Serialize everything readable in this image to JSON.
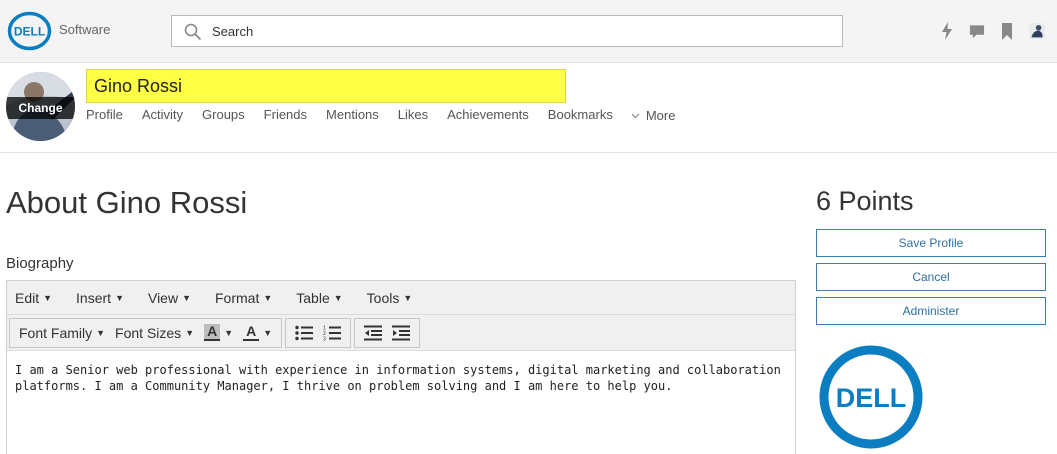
{
  "header": {
    "brand_text": "Software",
    "logo_text": "DELL",
    "search": {
      "placeholder": "Search",
      "value": ""
    },
    "icons": [
      "lightning-icon",
      "chat-icon",
      "bookmark-icon",
      "user-avatar"
    ]
  },
  "profile": {
    "avatar_change_label": "Change",
    "name": "Gino Rossi",
    "nav": [
      "Profile",
      "Activity",
      "Groups",
      "Friends",
      "Mentions",
      "Likes",
      "Achievements",
      "Bookmarks"
    ],
    "more_label": "More"
  },
  "main": {
    "title": "About Gino Rossi",
    "biography_label": "Biography",
    "editor": {
      "menus": [
        "Edit",
        "Insert",
        "View",
        "Format",
        "Table",
        "Tools"
      ],
      "font_family_label": "Font Family",
      "font_sizes_label": "Font Sizes",
      "bg_color_glyph": "A",
      "text_color_glyph": "A",
      "content": "I am a Senior web professional with experience in information systems, digital marketing and collaboration platforms.  I am a Community Manager, I thrive on problem solving and I am here to help you."
    }
  },
  "sidebar": {
    "points": "6 Points",
    "save_label": "Save Profile",
    "cancel_label": "Cancel",
    "administer_label": "Administer",
    "logo_text": "DELL"
  },
  "colors": {
    "dell_blue": "#0b7dc1",
    "highlight": "#ffff44",
    "button_text": "#2f6ea5"
  }
}
